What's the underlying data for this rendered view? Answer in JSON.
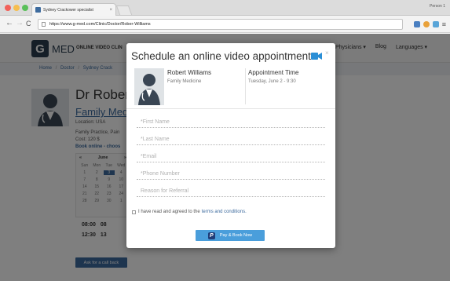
{
  "browser": {
    "tab_title": "Sydney Crackower specialist",
    "tab_close": "×",
    "profile": "Person 1",
    "nav_back": "←",
    "nav_forward": "→",
    "nav_reload": "C",
    "url": "https://www.g-med.com/Clinic/Doctor/Rober-Williams",
    "menu": "≡"
  },
  "site": {
    "logo_letter": "G",
    "logo_text": "MED",
    "tagline": "ONLINE VIDEO CLIN",
    "nav": [
      "Physicians ▾",
      "Blog",
      "Languages ▾"
    ]
  },
  "breadcrumb": [
    "Home",
    "Doctor",
    "Sydney Crack"
  ],
  "breadcrumb_sep": "/",
  "doctor_page": {
    "name": "Dr Rober",
    "specialty": "Family Med",
    "location": "Location: USA",
    "practice": "Family Practice, Pain",
    "cost": "Cost: 120 $",
    "booking": "Book online - choos",
    "calendar": {
      "prev": "«",
      "next": "»",
      "month": "June",
      "days": [
        "Sun",
        "Mon",
        "Tue",
        "Wed",
        "1",
        "2",
        "3",
        "4",
        "7",
        "8",
        "9",
        "10",
        "14",
        "15",
        "16",
        "17",
        "21",
        "22",
        "23",
        "24",
        "28",
        "29",
        "30",
        "1"
      ]
    },
    "slots": [
      [
        "08:00",
        "08"
      ],
      [
        "12:30",
        "13"
      ]
    ],
    "callback": "Ask for a call back"
  },
  "modal": {
    "title": "Schedule an online video appointment",
    "close": "×",
    "doctor_name": "Robert Williams",
    "doctor_specialty": "Family Medicine",
    "appt_label": "Appointment Time",
    "appt_value": "Tuesday, June 2 - 9:30",
    "fields": {
      "first_name": "*First Name",
      "last_name": "*Last Name",
      "email": "*Email",
      "phone": "*Phone Number",
      "reason": "Reason for Referral"
    },
    "agree_text": "I have read and agreed to the",
    "agree_link": "terms and conditions.",
    "pay_logo": "P",
    "pay_button": "Pay & Book Now"
  },
  "colors": {
    "accent": "#3d6b9e",
    "pay_button": "#4a9edb",
    "camera_icon": "#2b8fd6"
  }
}
